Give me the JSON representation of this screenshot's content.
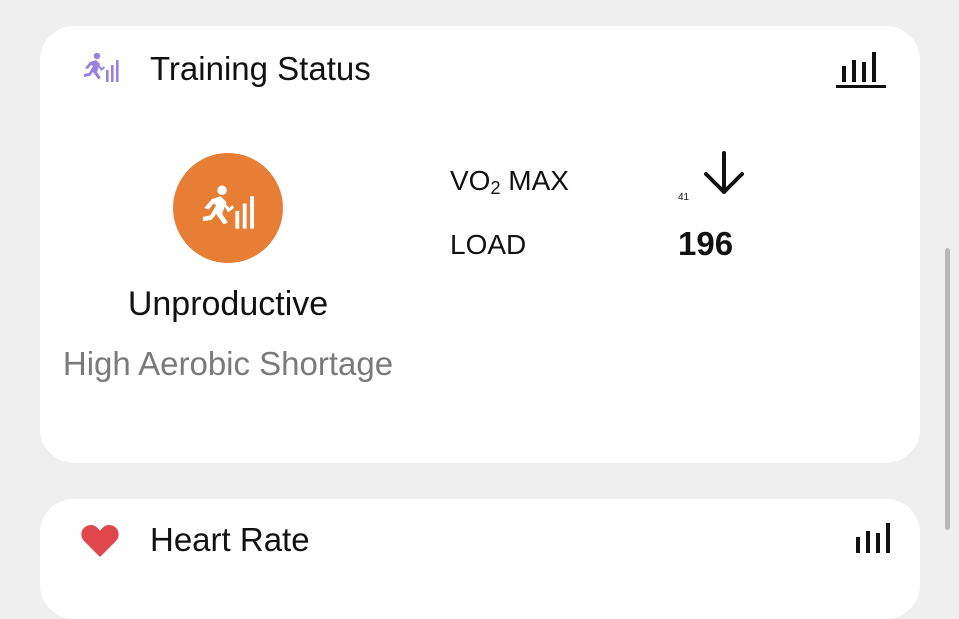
{
  "training_card": {
    "title": "Training Status",
    "title_icon": "runner-bars-icon",
    "chart_icon": "bar-chart-icon",
    "status_icon": "runner-bars-icon",
    "status_color": "#e67e36",
    "status": "Unproductive",
    "status_detail": "High Aerobic Shortage",
    "vo2_label_main": "VO",
    "vo2_label_sub": "2",
    "vo2_label_rest": " MAX",
    "vo2_value": "41",
    "vo2_trend_icon": "arrow-down-icon",
    "load_label": "LOAD",
    "load_value": "196"
  },
  "heart_card": {
    "title": "Heart Rate",
    "icon": "heart-icon",
    "chart_icon": "bar-chart-icon"
  },
  "colors": {
    "background": "#efeff0",
    "card": "#ffffff",
    "accent_purple": "#9a82dc",
    "status_orange": "#e67e36",
    "heart_red": "#e0474c"
  }
}
